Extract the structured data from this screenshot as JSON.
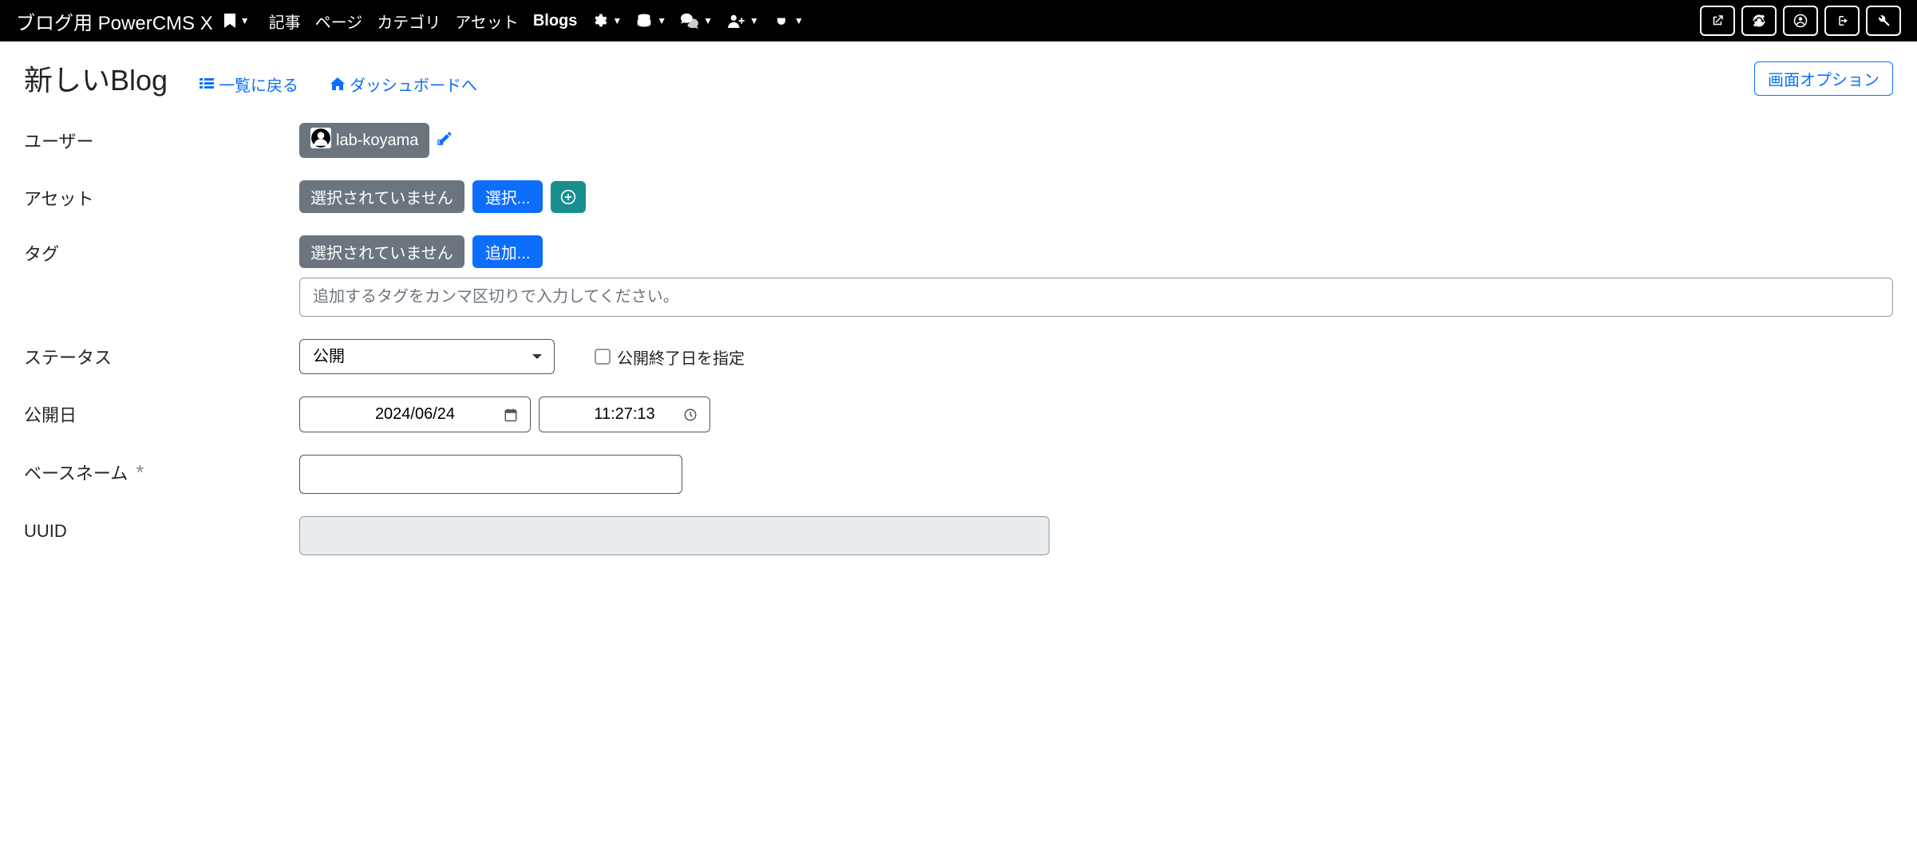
{
  "navbar": {
    "brand": "ブログ用 PowerCMS X",
    "items": [
      {
        "label": "記事"
      },
      {
        "label": "ページ"
      },
      {
        "label": "カテゴリ"
      },
      {
        "label": "アセット"
      },
      {
        "label": "Blogs",
        "active": true
      }
    ]
  },
  "header": {
    "title": "新しいBlog",
    "back_to_list": "一覧に戻る",
    "dashboard": "ダッシュボードへ",
    "screen_option": "画面オプション"
  },
  "form": {
    "user": {
      "label": "ユーザー",
      "value": "lab-koyama"
    },
    "asset": {
      "label": "アセット",
      "none": "選択されていません",
      "select_btn": "選択..."
    },
    "tag": {
      "label": "タグ",
      "none": "選択されていません",
      "add_btn": "追加...",
      "placeholder": "追加するタグをカンマ区切りで入力してください。"
    },
    "status": {
      "label": "ステータス",
      "value": "公開",
      "checkbox": "公開終了日を指定"
    },
    "published": {
      "label": "公開日",
      "date": "2024/06/24",
      "time": "11:27:13"
    },
    "basename": {
      "label": "ベースネーム",
      "value": ""
    },
    "uuid": {
      "label": "UUID",
      "value": ""
    }
  }
}
